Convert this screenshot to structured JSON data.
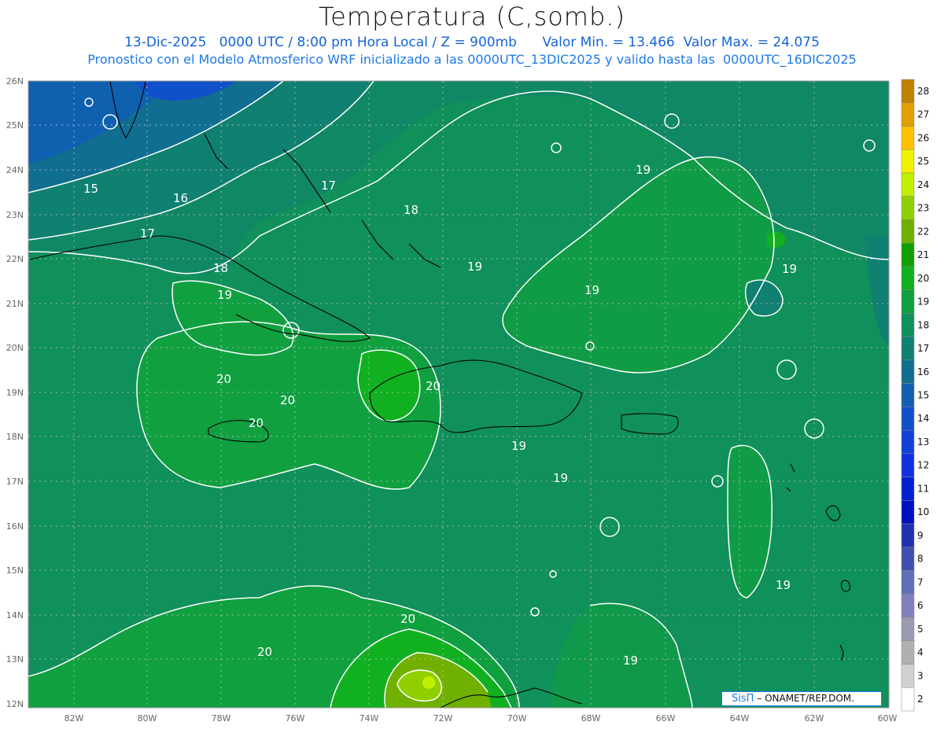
{
  "header": {
    "title": "Temperatura (C,somb.)",
    "date": "13-Dic-2025",
    "time_info": "0000 UTC / 8:00 pm Hora Local / Z = 900mb",
    "min_label": "Valor Min. = 13.466",
    "max_label": "Valor Max. = 24.075",
    "forecast_note": "Pronostico con el Modelo Atmosferico WRF inicializado a las 0000UTC_13DIC2025 y valido hasta las  0000UTC_16DIC2025"
  },
  "map": {
    "lon_labels": [
      "82W",
      "80W",
      "78W",
      "76W",
      "74W",
      "72W",
      "70W",
      "68W",
      "66W",
      "64W",
      "62W",
      "60W"
    ],
    "lat_labels": [
      "26N",
      "25N",
      "24N",
      "23N",
      "22N",
      "21N",
      "20N",
      "19N",
      "18N",
      "17N",
      "16N",
      "15N",
      "14N",
      "13N",
      "12N"
    ],
    "contour_labels": [
      "15",
      "16",
      "17",
      "17",
      "18",
      "18",
      "19",
      "19",
      "19",
      "19",
      "19",
      "19",
      "19",
      "19",
      "20",
      "20",
      "20",
      "20",
      "20",
      "20"
    ],
    "colors": {
      "land_line": "#000000",
      "contour": "#ffffff",
      "grid": "#b0b0b0"
    }
  },
  "colorbar": {
    "labels": [
      "28",
      "27",
      "26",
      "25",
      "24",
      "23",
      "22",
      "21",
      "20",
      "19",
      "18",
      "17",
      "16",
      "15",
      "14",
      "13",
      "12",
      "11",
      "10",
      "9",
      "8",
      "7",
      "6",
      "5",
      "4",
      "3",
      "2"
    ],
    "colors": [
      "#c08000",
      "#e0a000",
      "#ffc000",
      "#f0f000",
      "#c0f000",
      "#90d000",
      "#70b000",
      "#10a000",
      "#10b020",
      "#10a040",
      "#10905a",
      "#108070",
      "#106e90",
      "#1060b0",
      "#1050c8",
      "#1040d8",
      "#1030e0",
      "#0020d0",
      "#0010c0",
      "#2030b0",
      "#4050b0",
      "#6070b8",
      "#8080c0",
      "#9a9ab0",
      "#b0b0b0",
      "#d0d0d0",
      "#ffffff"
    ]
  },
  "credit": {
    "logo": "SisΠ",
    "text": "– ONAMET/REP.DOM."
  }
}
